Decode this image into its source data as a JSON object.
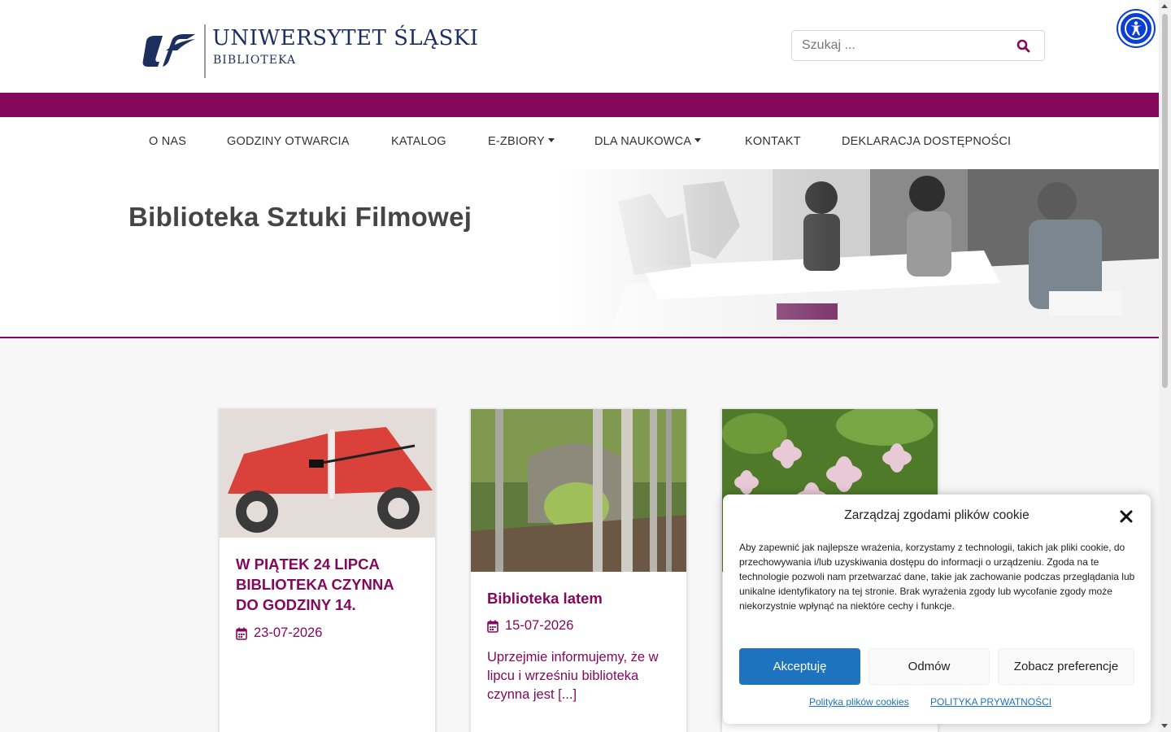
{
  "header": {
    "logo_title": "UNIWERSYTET ŚLĄSKI",
    "logo_subtitle": "BIBLIOTEKA",
    "search_placeholder": "Szukaj ..."
  },
  "colors": {
    "brand_purple": "#84095c",
    "logo_navy": "#1c2f5e",
    "accent_blue": "#1e73be",
    "a11y_blue": "#0a3fd3"
  },
  "nav": {
    "items": [
      {
        "label": "O NAS",
        "dropdown": false
      },
      {
        "label": "GODZINY OTWARCIA",
        "dropdown": false
      },
      {
        "label": "KATALOG",
        "dropdown": false
      },
      {
        "label": "E-ZBIORY",
        "dropdown": true
      },
      {
        "label": "DLA NAUKOWCA",
        "dropdown": true
      },
      {
        "label": "KONTAKT",
        "dropdown": false
      },
      {
        "label": "DEKLARACJA DOSTĘPNOŚCI",
        "dropdown": false
      }
    ]
  },
  "hero": {
    "title": "Biblioteka Sztuki Filmowej"
  },
  "posts": [
    {
      "title": "W PIĄTEK 24 LIPCA BIBLIOTEKA CZYNNA DO GODZINY 14.",
      "date": "23-07-2026",
      "excerpt": ""
    },
    {
      "title": "Biblioteka latem",
      "date": "15-07-2026",
      "excerpt": "Uprzejmie informujemy, że w lipcu i wrześniu biblioteka czynna jest [...]"
    },
    {
      "title": "",
      "date": "",
      "excerpt": ""
    }
  ],
  "cookie": {
    "title": "Zarządzaj zgodami plików cookie",
    "text": "Aby zapewnić jak najlepsze wrażenia, korzystamy z technologii, takich jak pliki cookie, do przechowywania i/lub uzyskiwania dostępu do informacji o urządzeniu. Zgoda na te technologie pozwoli nam przetwarzać dane, takie jak zachowanie podczas przeglądania lub unikalne identyfikatory na tej stronie. Brak wyrażenia zgody lub wycofanie zgody może niekorzystnie wpłynąć na niektóre cechy i funkcje.",
    "accept_label": "Akceptuję",
    "deny_label": "Odmów",
    "prefs_label": "Zobacz preferencje",
    "link_cookies": "Polityka plików cookies",
    "link_privacy": "POLITYKA PRYWATNOŚCI"
  },
  "icons": {
    "search": "search-icon",
    "accessibility": "accessibility-icon",
    "calendar": "calendar-icon",
    "close": "close-icon"
  }
}
